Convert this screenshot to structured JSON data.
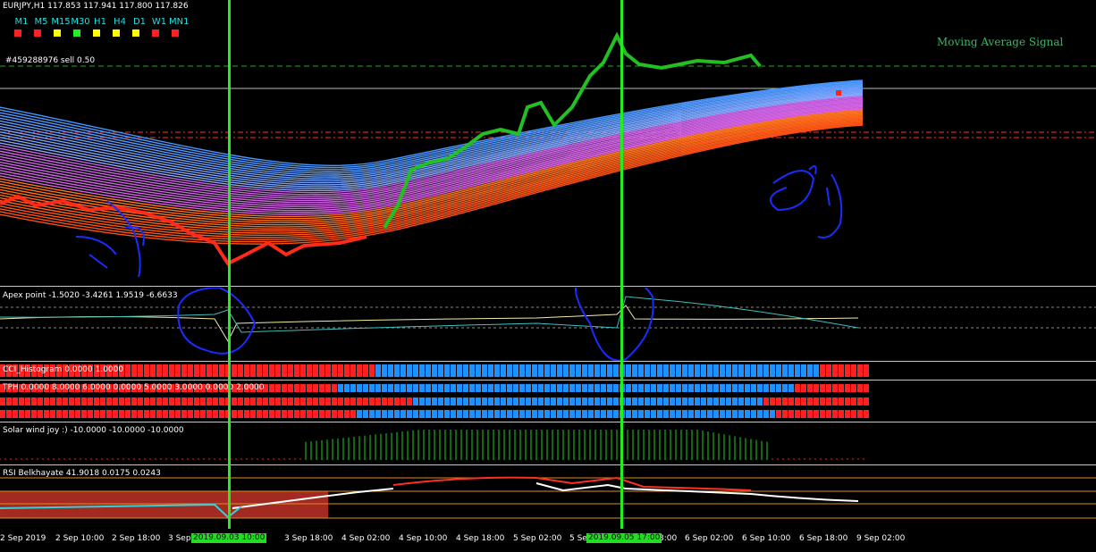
{
  "header": {
    "symbol_line": "EURJPY,H1  117.853 117.941 117.800 117.826",
    "timeframes": [
      "M1",
      "M5",
      "M15",
      "M30",
      "H1",
      "H4",
      "D1",
      "W1",
      "MN1"
    ],
    "timeframe_colors": [
      "#ff2020",
      "#ff2020",
      "#ffff00",
      "#22ee22",
      "#ffff00",
      "#ffff00",
      "#ffff00",
      "#ff2020",
      "#ff2020"
    ],
    "order_label": "#459288976 sell 0.50",
    "signal_label": "Moving Average Signal"
  },
  "indicators": {
    "apex": "Apex point -1.5020 -3.4261 1.9519 -6.6633",
    "cci": "CCI_Histogram 0.0000 1.0000",
    "tph": "TPH 0.0000 8.0000 6.0000 0.0000 5.0000 3.0000 0.0000 2.0000",
    "solar": "Solar wind joy :) -10.0000 -10.0000 -10.0000",
    "rsi": "RSI Belkhayate 41.9018 0.0175 0.0243"
  },
  "time_axis": {
    "ticks": [
      "2 Sep 2019",
      "2 Sep 10:00",
      "2 Sep 18:00",
      "3 Sep",
      "3 Sep 18:00",
      "4 Sep 02:00",
      "4 Sep 10:00",
      "4 Sep 18:00",
      "5 Sep 02:00",
      "5 Se",
      "8:00",
      "6 Sep 02:00",
      "6 Sep 10:00",
      "6 Sep 18:00",
      "9 Sep 02:00"
    ],
    "highlight_1": "2019.09.03 10:00",
    "highlight_2": "2019.09.05 17:00"
  },
  "colors": {
    "vertical_marker": "#22ee22",
    "bull": "#1e90ff",
    "bear": "#ff2020"
  }
}
